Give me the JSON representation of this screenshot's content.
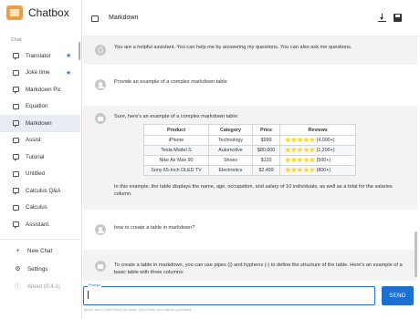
{
  "app": {
    "name": "Chatbox",
    "logo_color": "#e8a14a",
    "accent": "#1e6fd0"
  },
  "sidebar": {
    "section_label": "Chat",
    "items": [
      {
        "label": "Translator",
        "starred": true,
        "active": false
      },
      {
        "label": "Joke time",
        "starred": true,
        "active": false
      },
      {
        "label": "Markdown Pic",
        "starred": false,
        "active": false
      },
      {
        "label": "Equation",
        "starred": false,
        "active": false
      },
      {
        "label": "Markdown",
        "starred": false,
        "active": true
      },
      {
        "label": "Assist",
        "starred": false,
        "active": false
      },
      {
        "label": "Tutorial",
        "starred": false,
        "active": false
      },
      {
        "label": "Untitled",
        "starred": false,
        "active": false
      },
      {
        "label": "Calculus Q&A",
        "starred": false,
        "active": false
      },
      {
        "label": "Calculus",
        "starred": false,
        "active": false
      },
      {
        "label": "Assistant.",
        "starred": false,
        "active": false
      }
    ],
    "new_chat": "New Chat",
    "settings": "Settings",
    "about": "About (0.4.1)"
  },
  "header": {
    "title": "Markdown",
    "icons": [
      "download-icon",
      "save-icon"
    ]
  },
  "messages": [
    {
      "role": "system",
      "text": "You are a helpful assistant. You can help me by answering my questions. You can also ask me questions."
    },
    {
      "role": "user",
      "text": "Provide an example of a complex markdown table"
    },
    {
      "role": "assistant",
      "intro": "Sure, here's an example of a complex markdown table:",
      "table": {
        "headers": [
          "Product",
          "Category",
          "Price",
          "Reviews"
        ],
        "rows": [
          [
            "iPhone",
            "Technology",
            "$999",
            "⭐⭐⭐⭐⭐ (4,000+)"
          ],
          [
            "Tesla Model S",
            "Automotive",
            "$80,000",
            "⭐⭐⭐⭐⭐ (1,200+)"
          ],
          [
            "Nike Air Max 90",
            "Shoes",
            "$120",
            "⭐⭐⭐⭐⭐ (500+)"
          ],
          [
            "Sony 65-Inch OLED TV",
            "Electronics",
            "$2,499",
            "⭐⭐⭐⭐⭐ (800+)"
          ]
        ]
      },
      "outro": "In this example, the table displays the name, age, occupation, and salary of 10 individuals, as well as a total for the salaries column."
    },
    {
      "role": "user",
      "text": "how to create a table in markdown?"
    },
    {
      "role": "assistant",
      "text": "To create a table in markdown, you can use pipes (|) and hyphens (-) to define the structure of the table. Here's an example of a basic table with three columns:"
    }
  ],
  "input": {
    "label": "Prompt",
    "value": "",
    "placeholder": ""
  },
  "send_label": "SEND",
  "hint": "[Enter] send, [Shift+Enter] line break, [Ctrl+Enter] send without generating"
}
